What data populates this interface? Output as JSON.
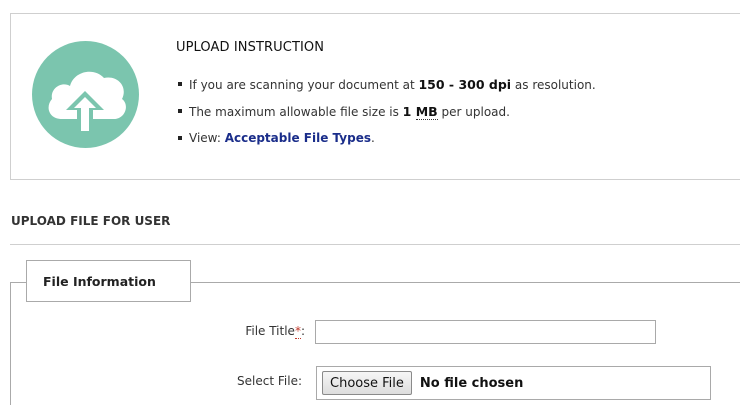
{
  "instruction": {
    "icon": "cloud-upload-icon",
    "icon_color": "#7bc5ae",
    "title": "UPLOAD INSTRUCTION",
    "items": [
      {
        "prefix": "If you are scanning your document at ",
        "bold": "150 - 300 dpi",
        "suffix": " as resolution."
      },
      {
        "prefix": "The maximum allowable file size is ",
        "bold_num": "1",
        "bold_unit": "MB",
        "suffix": " per upload."
      },
      {
        "prefix": "View: ",
        "link": "Acceptable File Types",
        "suffix": "."
      }
    ]
  },
  "section": {
    "title": "UPLOAD FILE FOR USER"
  },
  "file_information": {
    "legend": "File Information",
    "file_title": {
      "label": "File Title",
      "required_mark": "*",
      "colon": ":",
      "value": ""
    },
    "select_file": {
      "label": "Select File:",
      "button": "Choose File",
      "status": "No file chosen"
    }
  }
}
